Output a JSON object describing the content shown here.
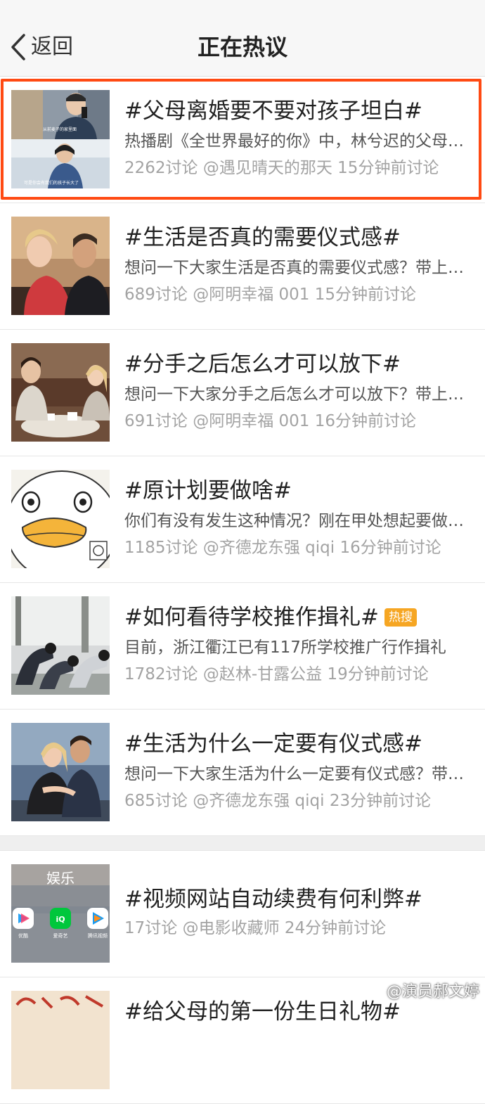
{
  "header": {
    "back_label": "返回",
    "title": "正在热议"
  },
  "items": [
    {
      "title": "#父母离婚要不要对孩子坦白#",
      "desc": "热播剧《全世界最好的你》中，林兮迟的父母离婚…",
      "count": "2262讨论",
      "user": "@遇见晴天的那天",
      "time": "15分钟前讨论",
      "thumb_caption_1": "从前麦子的家里面",
      "thumb_caption_2": "可是你会有我们的孩子长大了"
    },
    {
      "title": "#生活是否真的需要仪式感#",
      "desc": "想问一下大家生活是否真的需要仪式感？带上话题",
      "count": "689讨论",
      "user": "@阿明幸福 001",
      "time": "15分钟前讨论"
    },
    {
      "title": "#分手之后怎么才可以放下#",
      "desc": "想问一下大家分手之后怎么才可以放下？带上话题",
      "count": "691讨论",
      "user": "@阿明幸福 001",
      "time": "16分钟前讨论"
    },
    {
      "title": "#原计划要做啥#",
      "desc": "你们有没有发生这种情况？刚在甲处想起要做什么",
      "count": "1185讨论",
      "user": "@齐德龙东强 qiqi",
      "time": "16分钟前讨论"
    },
    {
      "title": "#如何看待学校推作揖礼#",
      "badge": "热搜",
      "desc": "目前，浙江衢江已有117所学校推广行作揖礼",
      "count": "1782讨论",
      "user": "@赵林-甘露公益",
      "time": "19分钟前讨论"
    },
    {
      "title": "#生活为什么一定要有仪式感#",
      "desc": "想问一下大家生活为什么一定要有仪式感？带上话题",
      "count": "685讨论",
      "user": "@齐德龙东强 qiqi",
      "time": "23分钟前讨论"
    },
    {
      "title": "#视频网站自动续费有何利弊#",
      "count": "17讨论",
      "user": "@电影收藏师",
      "time": "24分钟前讨论",
      "thumb_label": "娱乐",
      "apps": [
        "优酷",
        "爱奇艺",
        "腾讯视频"
      ]
    },
    {
      "title": "#给父母的第一份生日礼物#"
    }
  ],
  "watermark": "@演员郝文婷",
  "colors": {
    "highlight": "#ff4a13",
    "badge": "#f6a623",
    "meta_text": "#a3a3a3"
  }
}
